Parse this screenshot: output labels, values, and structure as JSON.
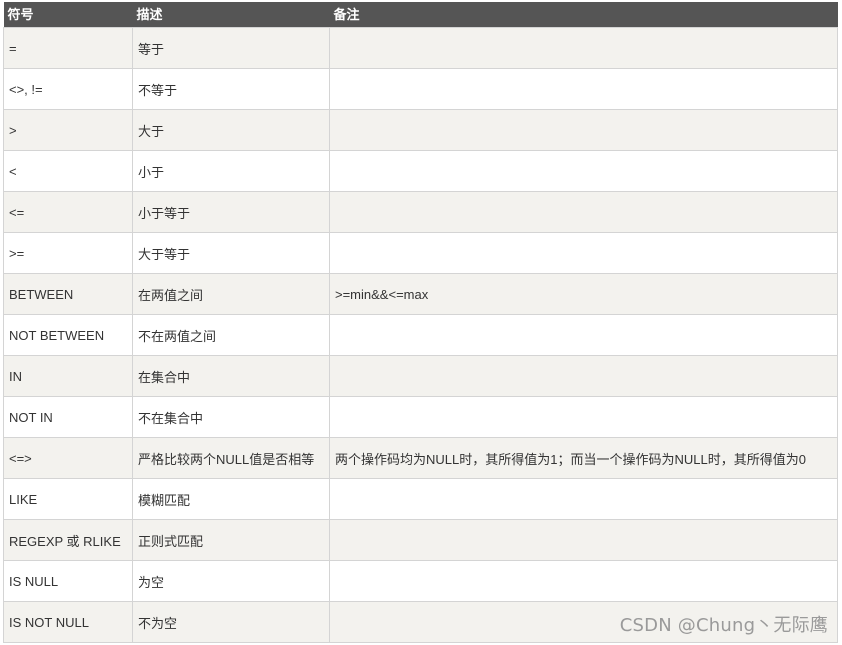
{
  "table": {
    "headers": [
      "符号",
      "描述",
      "备注"
    ],
    "rows": [
      {
        "symbol": "=",
        "description": "等于",
        "note": ""
      },
      {
        "symbol": "<>, !=",
        "description": "不等于",
        "note": ""
      },
      {
        "symbol": ">",
        "description": "大于",
        "note": ""
      },
      {
        "symbol": "<",
        "description": "小于",
        "note": ""
      },
      {
        "symbol": "<=",
        "description": "小于等于",
        "note": ""
      },
      {
        "symbol": ">=",
        "description": "大于等于",
        "note": ""
      },
      {
        "symbol": "BETWEEN",
        "description": "在两值之间",
        "note": ">=min&&<=max"
      },
      {
        "symbol": "NOT BETWEEN",
        "description": "不在两值之间",
        "note": ""
      },
      {
        "symbol": "IN",
        "description": "在集合中",
        "note": ""
      },
      {
        "symbol": "NOT IN",
        "description": "不在集合中",
        "note": ""
      },
      {
        "symbol": "<=>",
        "description": "严格比较两个NULL值是否相等",
        "note": "两个操作码均为NULL时，其所得值为1；而当一个操作码为NULL时，其所得值为0"
      },
      {
        "symbol": "LIKE",
        "description": "模糊匹配",
        "note": ""
      },
      {
        "symbol": "REGEXP 或 RLIKE",
        "description": "正则式匹配",
        "note": ""
      },
      {
        "symbol": "IS NULL",
        "description": "为空",
        "note": ""
      },
      {
        "symbol": "IS NOT NULL",
        "description": "不为空",
        "note": ""
      }
    ]
  },
  "watermark": "CSDN @Chung丶无际鹰"
}
